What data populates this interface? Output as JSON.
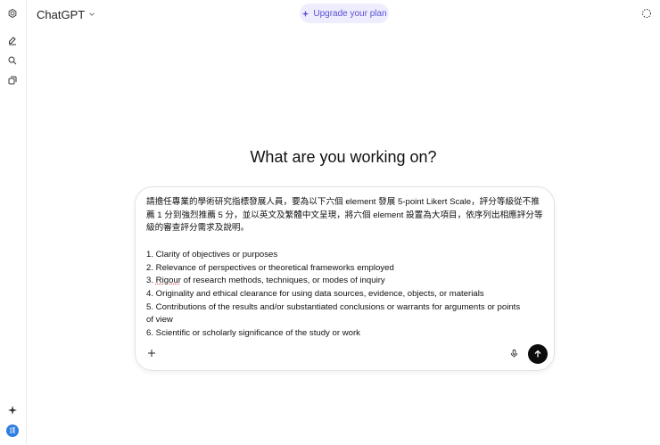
{
  "header": {
    "model_name": "ChatGPT",
    "upgrade_label": "Upgrade your plan"
  },
  "sidebar": {
    "icons": [
      "chatgpt-logo-icon",
      "new-chat-icon",
      "search-icon",
      "library-icon",
      "sparkle-icon"
    ],
    "avatar_initial": "謹"
  },
  "main": {
    "heading": "What are you working on?"
  },
  "composer": {
    "prompt_intro_1": "請擔任專業的學術研究指標發展人員，要為以下六個 element 發展 5-point Likert Scale，評分等級從不推",
    "prompt_intro_2": "薦 1 分到強烈推薦 5 分，並以英文及繁體中文呈現，將六個 element 設置為大項目，依序列出相應評分等",
    "prompt_intro_3": "級的審查評分需求及說明。",
    "items": [
      "1. Clarity of objectives or purposes",
      "2. Relevance of perspectives or theoretical frameworks employed",
      "3. ",
      "Rigour",
      " of research methods, techniques, or modes of inquiry",
      "4. Originality and ethical clearance for using data sources, evidence, objects, or materials",
      "5. Contributions of the results and/or substantiated conclusions or warrants for arguments or points",
      "of view",
      "6. Scientific or scholarly significance of the study or work"
    ]
  },
  "colors": {
    "accent": "#5b4fd6",
    "upgrade_bg": "#eeedfd",
    "send_bg": "#0d0d0d",
    "avatar_bg": "#2f7de1"
  }
}
